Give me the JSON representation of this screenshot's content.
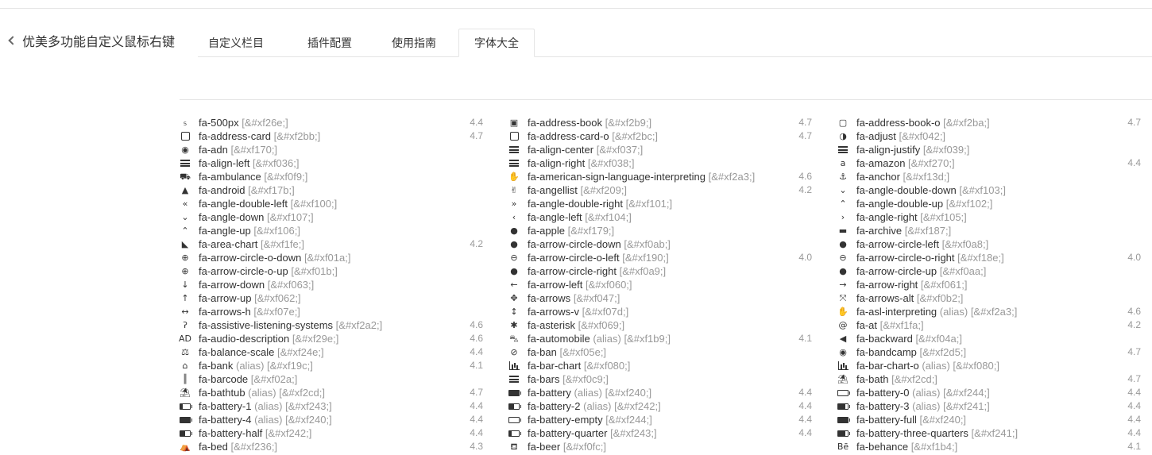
{
  "header": {
    "back_title": "优美多功能自定义鼠标右键"
  },
  "tabs": [
    {
      "label": "自定义栏目",
      "active": false
    },
    {
      "label": "插件配置",
      "active": false
    },
    {
      "label": "使用指南",
      "active": false
    },
    {
      "label": "字体大全",
      "active": true
    }
  ],
  "columns": [
    [
      {
        "name": "fa-500px",
        "code": "[&#xf26e;]",
        "version": "4.4",
        "icon": "500px-icon"
      },
      {
        "name": "fa-address-card",
        "code": "[&#xf2bb;]",
        "version": "4.7",
        "icon": "address-card-icon"
      },
      {
        "name": "fa-adn",
        "code": "[&#xf170;]",
        "version": "",
        "icon": "adn-icon"
      },
      {
        "name": "fa-align-left",
        "code": "[&#xf036;]",
        "version": "",
        "icon": "align-left-icon"
      },
      {
        "name": "fa-ambulance",
        "code": "[&#xf0f9;]",
        "version": "",
        "icon": "ambulance-icon"
      },
      {
        "name": "fa-android",
        "code": "[&#xf17b;]",
        "version": "",
        "icon": "android-icon"
      },
      {
        "name": "fa-angle-double-left",
        "code": "[&#xf100;]",
        "version": "",
        "icon": "angle-double-left-icon"
      },
      {
        "name": "fa-angle-down",
        "code": "[&#xf107;]",
        "version": "",
        "icon": "angle-down-icon"
      },
      {
        "name": "fa-angle-up",
        "code": "[&#xf106;]",
        "version": "",
        "icon": "angle-up-icon"
      },
      {
        "name": "fa-area-chart",
        "code": "[&#xf1fe;]",
        "version": "4.2",
        "icon": "area-chart-icon"
      },
      {
        "name": "fa-arrow-circle-o-down",
        "code": "[&#xf01a;]",
        "version": "",
        "icon": "arrow-circle-o-down-icon"
      },
      {
        "name": "fa-arrow-circle-o-up",
        "code": "[&#xf01b;]",
        "version": "",
        "icon": "arrow-circle-o-up-icon"
      },
      {
        "name": "fa-arrow-down",
        "code": "[&#xf063;]",
        "version": "",
        "icon": "arrow-down-icon"
      },
      {
        "name": "fa-arrow-up",
        "code": "[&#xf062;]",
        "version": "",
        "icon": "arrow-up-icon"
      },
      {
        "name": "fa-arrows-h",
        "code": "[&#xf07e;]",
        "version": "",
        "icon": "arrows-h-icon"
      },
      {
        "name": "fa-assistive-listening-systems",
        "code": "[&#xf2a2;]",
        "version": "4.6",
        "icon": "assistive-listening-icon"
      },
      {
        "name": "fa-audio-description",
        "code": "[&#xf29e;]",
        "version": "4.6",
        "icon": "audio-description-icon"
      },
      {
        "name": "fa-balance-scale",
        "code": "[&#xf24e;]",
        "version": "4.4",
        "icon": "balance-scale-icon"
      },
      {
        "name": "fa-bank",
        "alias": "(alias)",
        "code": "[&#xf19c;]",
        "version": "4.1",
        "icon": "bank-icon"
      },
      {
        "name": "fa-barcode",
        "code": "[&#xf02a;]",
        "version": "",
        "icon": "barcode-icon"
      },
      {
        "name": "fa-bathtub",
        "alias": "(alias)",
        "code": "[&#xf2cd;]",
        "version": "4.7",
        "icon": "bathtub-icon"
      },
      {
        "name": "fa-battery-1",
        "alias": "(alias)",
        "code": "[&#xf243;]",
        "version": "4.4",
        "icon": "battery-1-icon"
      },
      {
        "name": "fa-battery-4",
        "alias": "(alias)",
        "code": "[&#xf240;]",
        "version": "4.4",
        "icon": "battery-4-icon"
      },
      {
        "name": "fa-battery-half",
        "code": "[&#xf242;]",
        "version": "4.4",
        "icon": "battery-half-icon"
      },
      {
        "name": "fa-bed",
        "code": "[&#xf236;]",
        "version": "4.3",
        "icon": "bed-icon"
      }
    ],
    [
      {
        "name": "fa-address-book",
        "code": "[&#xf2b9;]",
        "version": "4.7",
        "icon": "address-book-icon"
      },
      {
        "name": "fa-address-card-o",
        "code": "[&#xf2bc;]",
        "version": "4.7",
        "icon": "address-card-o-icon"
      },
      {
        "name": "fa-align-center",
        "code": "[&#xf037;]",
        "version": "",
        "icon": "align-center-icon"
      },
      {
        "name": "fa-align-right",
        "code": "[&#xf038;]",
        "version": "",
        "icon": "align-right-icon"
      },
      {
        "name": "fa-american-sign-language-interpreting",
        "code": "[&#xf2a3;]",
        "version": "4.6",
        "icon": "sign-language-icon"
      },
      {
        "name": "fa-angellist",
        "code": "[&#xf209;]",
        "version": "4.2",
        "icon": "angellist-icon"
      },
      {
        "name": "fa-angle-double-right",
        "code": "[&#xf101;]",
        "version": "",
        "icon": "angle-double-right-icon"
      },
      {
        "name": "fa-angle-left",
        "code": "[&#xf104;]",
        "version": "",
        "icon": "angle-left-icon"
      },
      {
        "name": "fa-apple",
        "code": "[&#xf179;]",
        "version": "",
        "icon": "apple-icon"
      },
      {
        "name": "fa-arrow-circle-down",
        "code": "[&#xf0ab;]",
        "version": "",
        "icon": "arrow-circle-down-icon"
      },
      {
        "name": "fa-arrow-circle-o-left",
        "code": "[&#xf190;]",
        "version": "4.0",
        "icon": "arrow-circle-o-left-icon"
      },
      {
        "name": "fa-arrow-circle-right",
        "code": "[&#xf0a9;]",
        "version": "",
        "icon": "arrow-circle-right-icon"
      },
      {
        "name": "fa-arrow-left",
        "code": "[&#xf060;]",
        "version": "",
        "icon": "arrow-left-icon"
      },
      {
        "name": "fa-arrows",
        "code": "[&#xf047;]",
        "version": "",
        "icon": "arrows-icon"
      },
      {
        "name": "fa-arrows-v",
        "code": "[&#xf07d;]",
        "version": "",
        "icon": "arrows-v-icon"
      },
      {
        "name": "fa-asterisk",
        "code": "[&#xf069;]",
        "version": "",
        "icon": "asterisk-icon"
      },
      {
        "name": "fa-automobile",
        "alias": "(alias)",
        "code": "[&#xf1b9;]",
        "version": "4.1",
        "icon": "automobile-icon"
      },
      {
        "name": "fa-ban",
        "code": "[&#xf05e;]",
        "version": "",
        "icon": "ban-icon"
      },
      {
        "name": "fa-bar-chart",
        "code": "[&#xf080;]",
        "version": "",
        "icon": "bar-chart-icon"
      },
      {
        "name": "fa-bars",
        "code": "[&#xf0c9;]",
        "version": "",
        "icon": "bars-icon"
      },
      {
        "name": "fa-battery",
        "alias": "(alias)",
        "code": "[&#xf240;]",
        "version": "4.4",
        "icon": "battery-icon"
      },
      {
        "name": "fa-battery-2",
        "alias": "(alias)",
        "code": "[&#xf242;]",
        "version": "4.4",
        "icon": "battery-2-icon"
      },
      {
        "name": "fa-battery-empty",
        "code": "[&#xf244;]",
        "version": "4.4",
        "icon": "battery-empty-icon"
      },
      {
        "name": "fa-battery-quarter",
        "code": "[&#xf243;]",
        "version": "4.4",
        "icon": "battery-quarter-icon"
      },
      {
        "name": "fa-beer",
        "code": "[&#xf0fc;]",
        "version": "",
        "icon": "beer-icon"
      }
    ],
    [
      {
        "name": "fa-address-book-o",
        "code": "[&#xf2ba;]",
        "version": "4.7",
        "icon": "address-book-o-icon"
      },
      {
        "name": "fa-adjust",
        "code": "[&#xf042;]",
        "version": "",
        "icon": "adjust-icon"
      },
      {
        "name": "fa-align-justify",
        "code": "[&#xf039;]",
        "version": "",
        "icon": "align-justify-icon"
      },
      {
        "name": "fa-amazon",
        "code": "[&#xf270;]",
        "version": "4.4",
        "icon": "amazon-icon"
      },
      {
        "name": "fa-anchor",
        "code": "[&#xf13d;]",
        "version": "",
        "icon": "anchor-icon"
      },
      {
        "name": "fa-angle-double-down",
        "code": "[&#xf103;]",
        "version": "",
        "icon": "angle-double-down-icon"
      },
      {
        "name": "fa-angle-double-up",
        "code": "[&#xf102;]",
        "version": "",
        "icon": "angle-double-up-icon"
      },
      {
        "name": "fa-angle-right",
        "code": "[&#xf105;]",
        "version": "",
        "icon": "angle-right-icon"
      },
      {
        "name": "fa-archive",
        "code": "[&#xf187;]",
        "version": "",
        "icon": "archive-icon"
      },
      {
        "name": "fa-arrow-circle-left",
        "code": "[&#xf0a8;]",
        "version": "",
        "icon": "arrow-circle-left-icon"
      },
      {
        "name": "fa-arrow-circle-o-right",
        "code": "[&#xf18e;]",
        "version": "4.0",
        "icon": "arrow-circle-o-right-icon"
      },
      {
        "name": "fa-arrow-circle-up",
        "code": "[&#xf0aa;]",
        "version": "",
        "icon": "arrow-circle-up-icon"
      },
      {
        "name": "fa-arrow-right",
        "code": "[&#xf061;]",
        "version": "",
        "icon": "arrow-right-icon"
      },
      {
        "name": "fa-arrows-alt",
        "code": "[&#xf0b2;]",
        "version": "",
        "icon": "arrows-alt-icon"
      },
      {
        "name": "fa-asl-interpreting",
        "alias": "(alias)",
        "code": "[&#xf2a3;]",
        "version": "4.6",
        "icon": "asl-interpreting-icon"
      },
      {
        "name": "fa-at",
        "code": "[&#xf1fa;]",
        "version": "4.2",
        "icon": "at-icon"
      },
      {
        "name": "fa-backward",
        "code": "[&#xf04a;]",
        "version": "",
        "icon": "backward-icon"
      },
      {
        "name": "fa-bandcamp",
        "code": "[&#xf2d5;]",
        "version": "4.7",
        "icon": "bandcamp-icon"
      },
      {
        "name": "fa-bar-chart-o",
        "alias": "(alias)",
        "code": "[&#xf080;]",
        "version": "",
        "icon": "bar-chart-o-icon"
      },
      {
        "name": "fa-bath",
        "code": "[&#xf2cd;]",
        "version": "4.7",
        "icon": "bath-icon"
      },
      {
        "name": "fa-battery-0",
        "alias": "(alias)",
        "code": "[&#xf244;]",
        "version": "4.4",
        "icon": "battery-0-icon"
      },
      {
        "name": "fa-battery-3",
        "alias": "(alias)",
        "code": "[&#xf241;]",
        "version": "4.4",
        "icon": "battery-3-icon"
      },
      {
        "name": "fa-battery-full",
        "code": "[&#xf240;]",
        "version": "4.4",
        "icon": "battery-full-icon"
      },
      {
        "name": "fa-battery-three-quarters",
        "code": "[&#xf241;]",
        "version": "4.4",
        "icon": "battery-three-quarters-icon"
      },
      {
        "name": "fa-behance",
        "code": "[&#xf1b4;]",
        "version": "4.1",
        "icon": "behance-icon"
      }
    ]
  ]
}
